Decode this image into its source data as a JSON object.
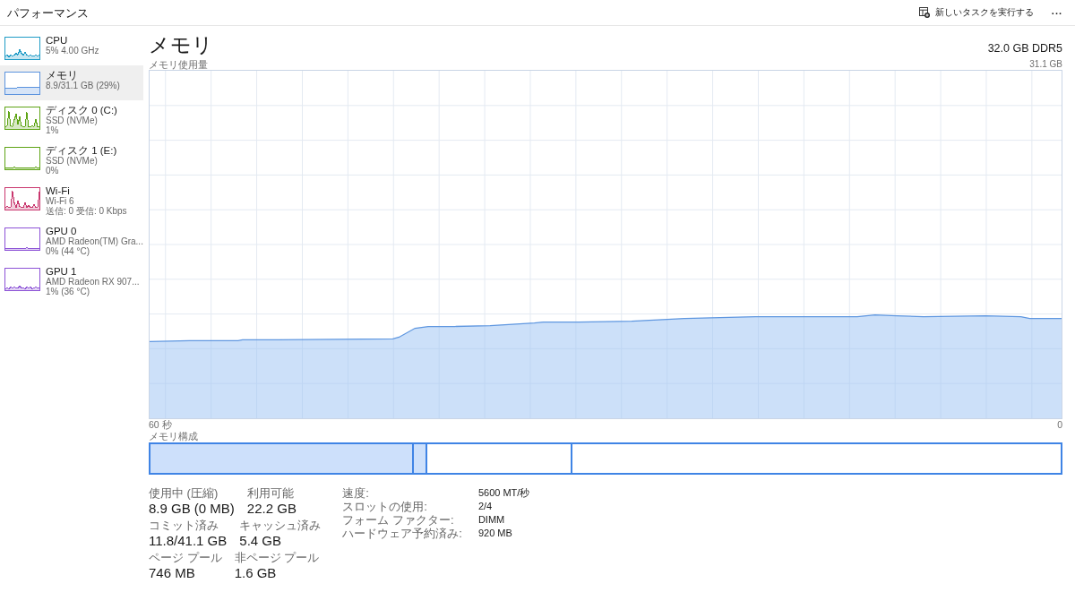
{
  "header": {
    "title": "パフォーマンス",
    "run_task": "新しいタスクを実行する",
    "more": "..."
  },
  "sidebar": {
    "items": [
      {
        "name": "CPU",
        "lines": [
          "5% 4.00 GHz"
        ],
        "color": "#1f9bc6",
        "selected": false
      },
      {
        "name": "メモリ",
        "lines": [
          "8.9/31.1 GB (29%)"
        ],
        "color": "#5b93de",
        "selected": true
      },
      {
        "name": "ディスク 0 (C:)",
        "lines": [
          "SSD (NVMe)",
          "1%"
        ],
        "color": "#5ea415",
        "selected": false
      },
      {
        "name": "ディスク 1 (E:)",
        "lines": [
          "SSD (NVMe)",
          "0%"
        ],
        "color": "#5ea415",
        "selected": false
      },
      {
        "name": "Wi-Fi",
        "lines": [
          "Wi-Fi 6",
          "送信: 0 受信: 0 Kbps"
        ],
        "color": "#c9376e",
        "selected": false
      },
      {
        "name": "GPU 0",
        "lines": [
          "AMD Radeon(TM) Gra...",
          "0% (44 °C)"
        ],
        "color": "#8c52d6",
        "selected": false
      },
      {
        "name": "GPU 1",
        "lines": [
          "AMD Radeon RX 907...",
          "1% (36 °C)"
        ],
        "color": "#8c52d6",
        "selected": false
      }
    ]
  },
  "memory": {
    "title": "メモリ",
    "capacity": "32.0 GB DDR5",
    "usage_chart": {
      "label": "メモリ使用量",
      "max_label": "31.1 GB",
      "start_label": "60 秒",
      "end_label": "0"
    },
    "composition": {
      "label": "メモリ構成"
    },
    "stats": [
      [
        {
          "label": "使用中 (圧縮)",
          "value": "8.9 GB (0 MB)"
        },
        {
          "label": "利用可能",
          "value": "22.2 GB"
        }
      ],
      [
        {
          "label": "コミット済み",
          "value": "11.8/41.1 GB"
        },
        {
          "label": "キャッシュ済み",
          "value": "5.4 GB"
        }
      ],
      [
        {
          "label": "ページ プール",
          "value": "746 MB"
        },
        {
          "label": "非ページ プール",
          "value": "1.6 GB"
        }
      ]
    ],
    "details": [
      {
        "label": "速度:",
        "value": "5600 MT/秒"
      },
      {
        "label": "スロットの使用:",
        "value": "2/4"
      },
      {
        "label": "フォーム ファクター:",
        "value": "DIMM"
      },
      {
        "label": "ハードウェア予約済み:",
        "value": "920 MB"
      }
    ]
  }
}
